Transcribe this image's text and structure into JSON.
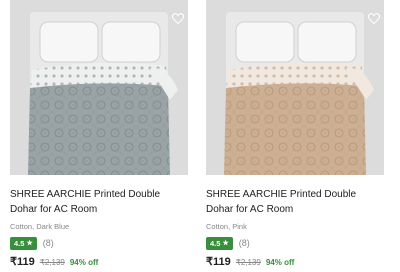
{
  "products": [
    {
      "title": "SHREE AARCHIE Printed Double Dohar for AC Room",
      "subtitle": "Cotton, Dark Blue",
      "rating": "4.5",
      "rating_star": "★",
      "rating_count": "(8)",
      "price": "₹119",
      "mrp": "₹2,139",
      "discount": "94% off",
      "quilt_color": "#9aa3a5",
      "quilt_pattern_color": "#838c8e",
      "fold_color": "#eef0f0",
      "wishlist_icon": "heart-outline-icon"
    },
    {
      "title": "SHREE AARCHIE Printed Double Dohar for AC Room",
      "subtitle": "Cotton, Pink",
      "rating": "4.5",
      "rating_star": "★",
      "rating_count": "(8)",
      "price": "₹119",
      "mrp": "₹2,139",
      "discount": "94% off",
      "quilt_color": "#cdb093",
      "quilt_pattern_color": "#b8997b",
      "fold_color": "#f1e8df",
      "wishlist_icon": "heart-outline-icon"
    }
  ],
  "colors": {
    "rating_badge": "#388e3c",
    "discount": "#388e3c",
    "muted_text": "#878787",
    "image_background": "#dcdcdc"
  }
}
